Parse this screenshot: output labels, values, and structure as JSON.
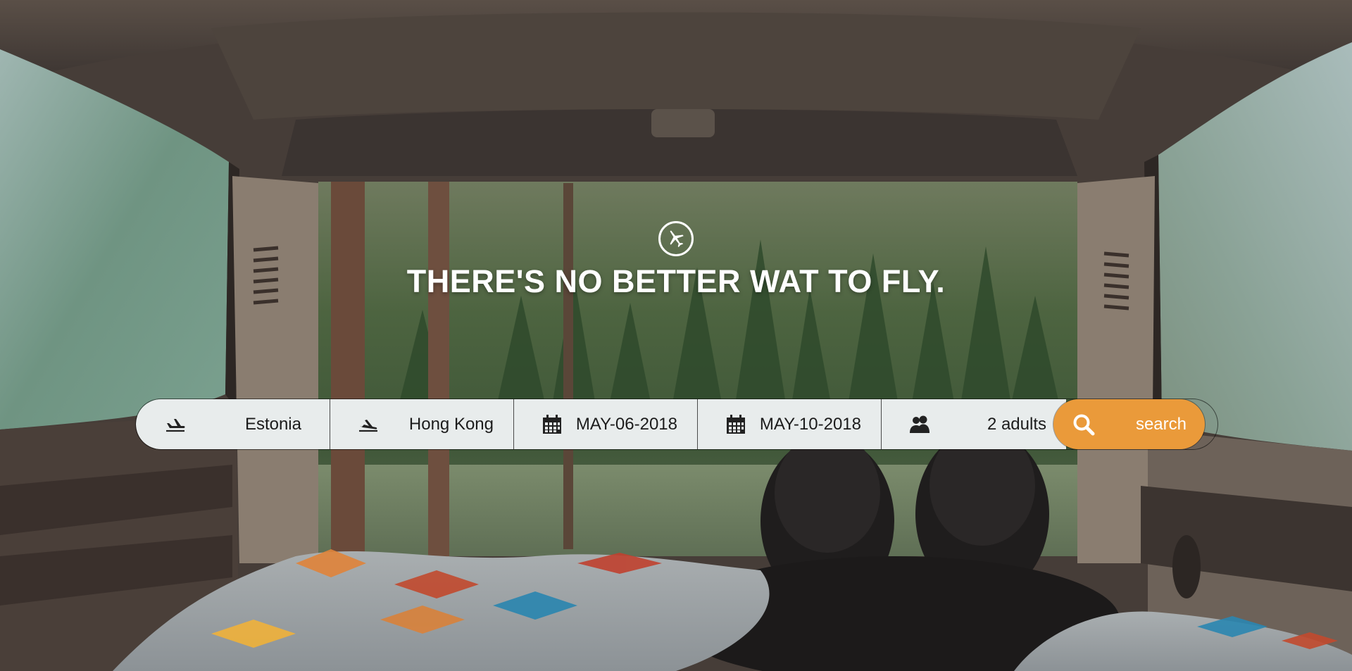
{
  "hero": {
    "headline": "THERE'S NO BETTER WAT TO FLY.",
    "badge_icon": "airplane-icon"
  },
  "search": {
    "from": {
      "icon": "plane-departure-icon",
      "value": "Estonia"
    },
    "to": {
      "icon": "plane-arrival-icon",
      "value": "Hong Kong"
    },
    "depart": {
      "icon": "calendar-icon",
      "value": "MAY-06-2018"
    },
    "return": {
      "icon": "calendar-icon",
      "value": "MAY-10-2018"
    },
    "passengers": {
      "icon": "people-icon",
      "value": "2 adults"
    },
    "button": {
      "icon": "search-icon",
      "label": "search"
    }
  },
  "colors": {
    "accent": "#ea9a3a",
    "field_bg": "#e8ecec",
    "headline": "#ffffff"
  }
}
